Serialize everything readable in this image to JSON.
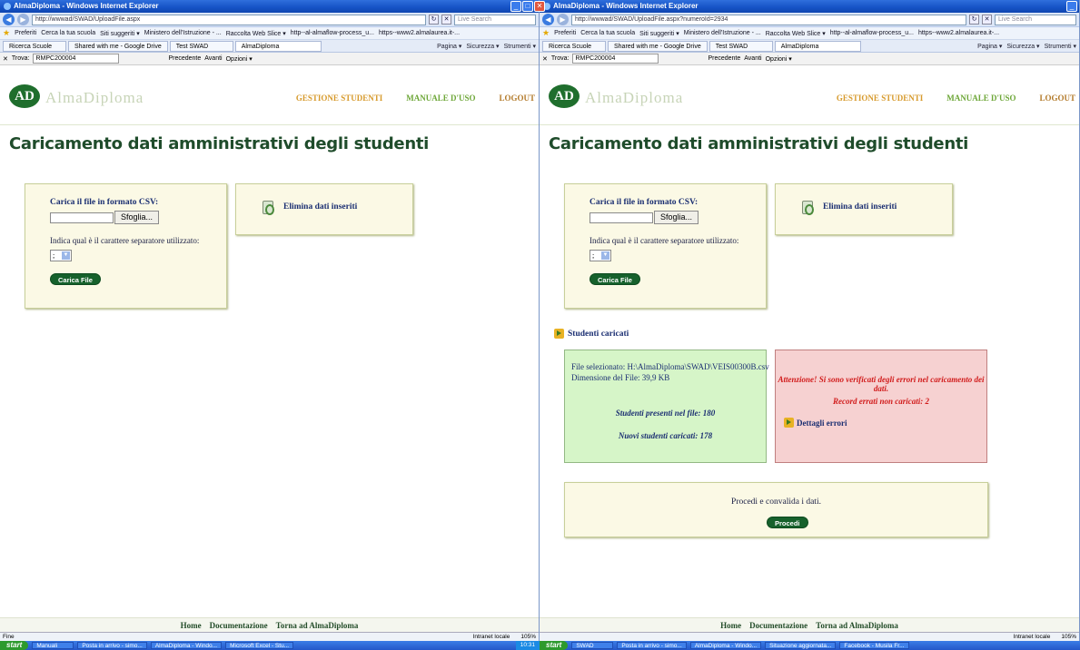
{
  "left": {
    "browser": {
      "title": "AlmaDiploma - Windows Internet Explorer",
      "url": "http://wwwad/SWAD/UploadFile.aspx",
      "search_placeholder": "Live Search",
      "favorites_label": "Preferiti",
      "favorites": [
        "Cerca la tua scuola",
        "Siti suggeriti ▾",
        "Ministero dell'Istruzione - ...",
        "Raccolta Web Slice ▾",
        "http--al-almaflow-process_u...",
        "https--www2.almalaurea.it-..."
      ],
      "tabs": [
        "Ricerca Scuole",
        "Shared with me - Google Drive",
        "Test SWAD",
        "AlmaDiploma"
      ],
      "command_items": [
        "Pagina ▾",
        "Sicurezza ▾",
        "Strumenti ▾"
      ],
      "find_label": "Trova:",
      "find_value": "RMPC200004",
      "find_prev": "Precedente",
      "find_next": "Avanti",
      "find_options": "Opzioni ▾"
    },
    "site": {
      "logo_badge": "AD",
      "logo_text": "AlmaDiploma",
      "nav": [
        "GESTIONE STUDENTI",
        "MANUALE D'USO",
        "LOGOUT"
      ],
      "page_title": "Caricamento dati amministrativi degli studenti",
      "upload_label": "Carica il file in formato CSV:",
      "browse_label": "Sfoglia...",
      "separator_label": "Indica qual è il carattere separatore utilizzato:",
      "separator_value": ";",
      "upload_button": "Carica File",
      "delete_label": "Elimina dati inseriti",
      "footer_links": [
        "Home",
        "Documentazione",
        "Torna ad AlmaDiploma"
      ]
    },
    "status": {
      "left_text": "Fine",
      "zone": "Intranet locale",
      "zoom": "105%"
    }
  },
  "right": {
    "browser": {
      "title": "AlmaDiploma - Windows Internet Explorer",
      "url": "http://wwwad/SWAD/UploadFile.aspx?numeroId=2934",
      "search_placeholder": "Live Search",
      "favorites_label": "Preferiti",
      "favorites": [
        "Cerca la tua scuola",
        "Siti suggeriti ▾",
        "Ministero dell'Istruzione - ...",
        "Raccolta Web Slice ▾",
        "http--al-almaflow-process_u...",
        "https--www2.almalaurea.it-..."
      ],
      "tabs": [
        "Ricerca Scuole",
        "Shared with me - Google Drive",
        "Test SWAD",
        "AlmaDiploma"
      ],
      "command_items": [
        "Pagina ▾",
        "Sicurezza ▾",
        "Strumenti ▾"
      ],
      "find_label": "Trova:",
      "find_value": "RMPC200004",
      "find_prev": "Precedente",
      "find_next": "Avanti",
      "find_options": "Opzioni ▾"
    },
    "site": {
      "logo_badge": "AD",
      "logo_text": "AlmaDiploma",
      "nav": [
        "GESTIONE STUDENTI",
        "MANUALE D'USO",
        "LOGOUT"
      ],
      "page_title": "Caricamento dati amministrativi degli studenti",
      "upload_label": "Carica il file in formato CSV:",
      "browse_label": "Sfoglia...",
      "separator_label": "Indica qual è il carattere separatore utilizzato:",
      "separator_value": ";",
      "upload_button": "Carica File",
      "delete_label": "Elimina dati inseriti",
      "caricati_heading": "Studenti caricati",
      "file_selected": "File selezionato: H:\\AlmaDiploma\\SWAD\\VEIS00300B.csv",
      "file_size": "Dimensione del File: 39,9 KB",
      "students_present": "Studenti presenti nel file: 180",
      "students_loaded": "Nuovi studenti caricati: 178",
      "error_message": "Attenzione! Si sono verificati degli errori nel caricamento dei dati.",
      "error_count": "Record errati non caricati: 2",
      "error_details": "Dettagli errori",
      "proceed_text": "Procedi e convalida i dati.",
      "proceed_button": "Procedi",
      "footer_links": [
        "Home",
        "Documentazione",
        "Torna ad AlmaDiploma"
      ]
    },
    "status": {
      "zone": "Intranet locale",
      "zoom": "105%"
    }
  },
  "taskbar": {
    "start_label": "start",
    "left_tasks": [
      "Manuali",
      "Posta in arrivo - simo...",
      "AlmaDiploma - Windo...",
      "Microsoft Excel - Stu..."
    ],
    "left_clock": "10:31",
    "right_tasks": [
      "SWAD",
      "Posta in arrivo - simo...",
      "AlmaDiploma - Windo...",
      "Situazione aggiornata...",
      "Facebook - Musila Fr..."
    ]
  },
  "colors": {
    "title_green": "#1f4c2b",
    "button_green": "#16612c",
    "success_bg": "#d6f5c8",
    "error_bg": "#f6d1d1",
    "error_text": "#d11b1b",
    "box_bg": "#fbf9e5"
  }
}
